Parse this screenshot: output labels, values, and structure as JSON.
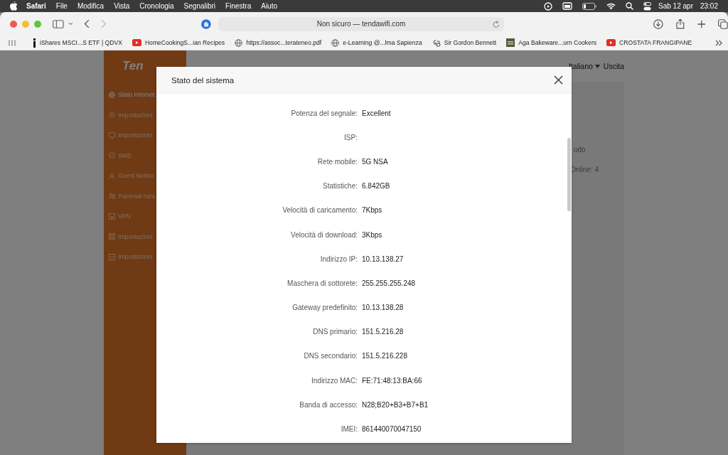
{
  "menubar": {
    "app": "Safari",
    "menus": [
      "File",
      "Modifica",
      "Vista",
      "Cronologia",
      "Segnalibri",
      "Finestra",
      "Aiuto"
    ],
    "date": "Sab 12 apr",
    "time": "23:02"
  },
  "toolbar": {
    "address": "Non sicuro — tendawifi.com"
  },
  "bookmarks": [
    {
      "kind": "ishares",
      "label": "iShares MSCI...S ETF | QDVX"
    },
    {
      "kind": "youtube",
      "label": "HomeCookingS...ian Recipes"
    },
    {
      "kind": "globe",
      "label": "https://assoc...terateneo.pdf"
    },
    {
      "kind": "globe",
      "label": "e-Learning @...lma Sapienza"
    },
    {
      "kind": "monogram",
      "label": "Sir Gordon Bennett"
    },
    {
      "kind": "square",
      "label": "Aga Bakeware...urn Cookers"
    },
    {
      "kind": "youtube",
      "label": "CROSTATA FRANGIPANE"
    }
  ],
  "router": {
    "logo": "Ten",
    "sidebar": [
      {
        "label": "Stato Internet",
        "selected": true
      },
      {
        "label": "Impostazioni",
        "selected": false
      },
      {
        "label": "Impostazioni",
        "selected": false
      },
      {
        "label": "SMS",
        "selected": false
      },
      {
        "label": "Guest Netwo",
        "selected": false
      },
      {
        "label": "Parental cont",
        "selected": false
      },
      {
        "label": "VPN",
        "selected": false
      },
      {
        "label": "Impostazioni",
        "selected": false
      },
      {
        "label": "Impostazioni",
        "selected": false
      }
    ],
    "language": "Italiano",
    "logout": "Uscita",
    "fragments": [
      "odo",
      "Online: 4"
    ]
  },
  "modal": {
    "title": "Stato del sistema",
    "rows": [
      {
        "label": "Potenza del segnale:",
        "value": "Excellent"
      },
      {
        "label": "ISP:"
      },
      {
        "label": "Rete mobile:",
        "value": "5G NSA"
      },
      {
        "label": "Statistiche:",
        "value": "6.842GB"
      },
      {
        "label": "Velocità di caricamento:",
        "value": "7Kbps"
      },
      {
        "label": "Velocità di download:",
        "value": "3Kbps"
      },
      {
        "label": "Indirizzo IP:",
        "value": "10.13.138.27"
      },
      {
        "label": "Maschera di sottorete:",
        "value": "255.255.255.248"
      },
      {
        "label": "Gateway predefinito:",
        "value": "10.13.138.28"
      },
      {
        "label": "DNS primario:",
        "value": "151.5.216.28"
      },
      {
        "label": "DNS secondario:",
        "value": "151.5.216.228"
      },
      {
        "label": "Indirizzo MAC:",
        "value": "FE:71:48:13:BA:66"
      },
      {
        "label": "Banda di accesso:",
        "value": "N28;B20+B3+B7+B1"
      },
      {
        "label": "IMEI:",
        "value": "861440070047150"
      }
    ]
  }
}
